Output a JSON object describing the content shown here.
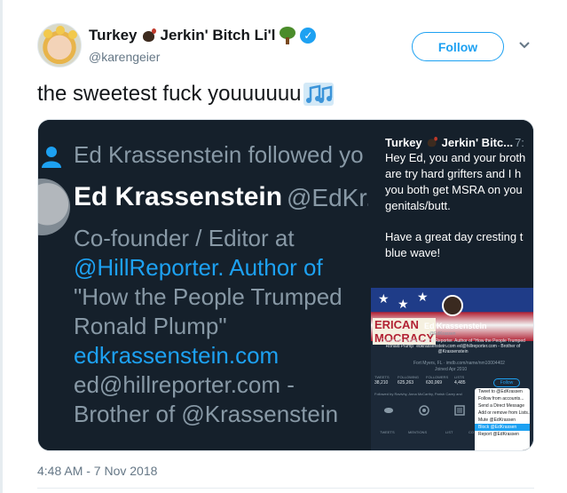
{
  "author": {
    "display_name_part1": "Turkey",
    "display_name_part2": "Jerkin' Bitch Li'l",
    "handle": "@karengeier",
    "verified": true,
    "emoji_icons": [
      "turkey-icon",
      "tree-icon"
    ]
  },
  "actions": {
    "follow_label": "Follow"
  },
  "tweet": {
    "text": "the sweetest fuck youuuuuu",
    "emoji_icon": "musical-notes-icon",
    "timestamp": "4:48 AM - 7 Nov 2018"
  },
  "media": {
    "left": {
      "followed_text": "Ed Krassenstein followed yo",
      "profile_name": "Ed Krassenstein",
      "profile_handle": "@EdKr...",
      "bio_lines": [
        "Co-founder / Editor at",
        "@HillReporter. Author of",
        "\"How the People Trumped",
        "Ronald Plump\"",
        "edkrassenstein.com",
        "ed@hillreporter.com -",
        "Brother of @Krassenstein"
      ]
    },
    "right_top": {
      "name": "Turkey",
      "name_rest": "Jerkin' Bitc...",
      "time_fragment": "7:",
      "lines": [
        "Hey Ed, you and your broth",
        "are try hard grifters and I h",
        "you both get MSRA on you",
        "genitals/butt."
      ],
      "lines2": [
        "Have a great day cresting t",
        "blue wave!"
      ]
    },
    "right_bottom": {
      "banner_text": "ERICAN",
      "banner_text2": "MOCRACY",
      "profile_name": "Ed Krassenstein",
      "handle": "@EdKrassen",
      "bio": "Co-founder / Editor at @HillReporter. Author of \"How the People Trumped Ronald Plump\" edkrassenstein.com ed@hillreporter.com - Brother of @Krassenstein",
      "location": "Fort Myers, FL · imdb.com/name/nm10004402",
      "joined": "Joined Apr 2010",
      "stats_labels": [
        "TWEETS",
        "FOLLOWING",
        "FOLLOWERS",
        "LISTS"
      ],
      "stats_values": [
        "38,210",
        "625,263",
        "630,069",
        "4,485"
      ],
      "followed_by": "Followed by Ravivhy, Anna McCarthy, Parish Carey and",
      "follow_label": "Follow",
      "menu_items": [
        "Tweet to @EdKrassen",
        "Follow from accounts...",
        "Send a Direct Message",
        "Add or remove from Lists...",
        "Mute @EdKrassen",
        "Block @EdKrassen",
        "Report @EdKrassen"
      ],
      "bottom_labels": [
        "TWEETS",
        "MENTIONS",
        "LIST",
        "CO"
      ]
    }
  }
}
